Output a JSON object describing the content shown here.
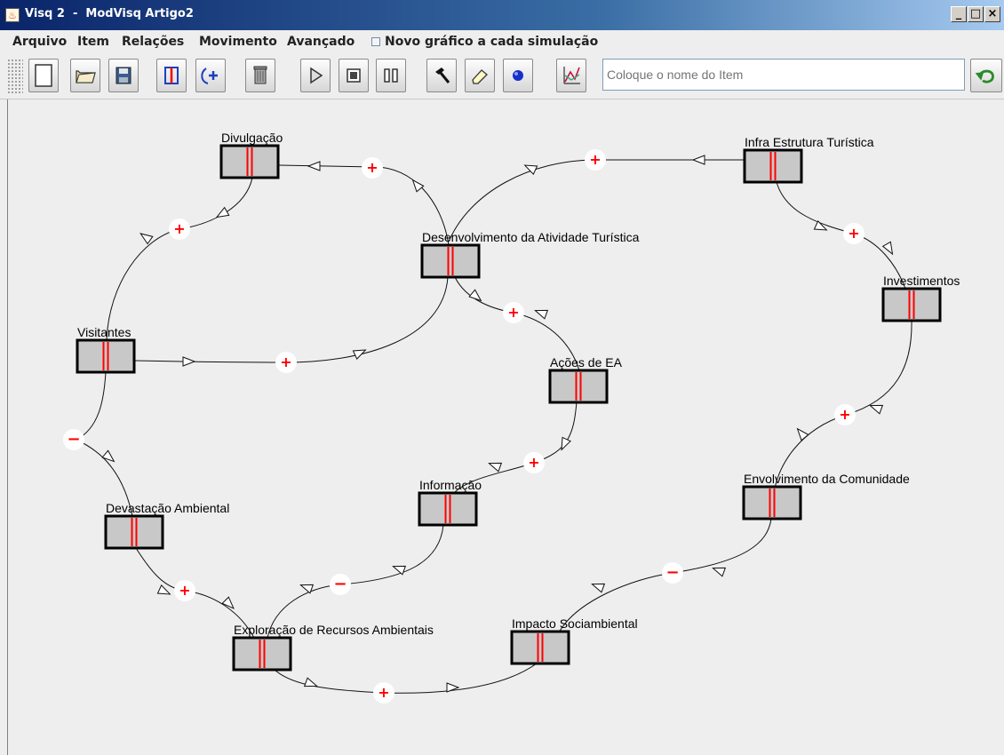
{
  "window": {
    "title": "Visq 2  -  ModVisq Artigo2"
  },
  "menu": {
    "items": [
      "Arquivo",
      "Item",
      "Relações",
      "Movimento",
      "Avançado"
    ],
    "checkbox_label": "Novo gráfico a cada simulação"
  },
  "toolbar": {
    "buttons": [
      "new-file-icon",
      "open-folder-icon",
      "save-disk-icon",
      "add-item-icon",
      "add-relation-icon",
      "trash-icon",
      "play-icon",
      "stop-icon",
      "pause-icon",
      "hammer-icon",
      "eraser-icon",
      "sphere-icon",
      "graph-icon"
    ],
    "item_name_placeholder": "Coloque o nome do Item",
    "undo_icon": "undo-icon"
  },
  "diagram": {
    "nodes": [
      {
        "label": "Divulgação"
      },
      {
        "label": "Infra Estrutura Turística"
      },
      {
        "label": "Desenvolvimento da Atividade Turística"
      },
      {
        "label": "Investimentos"
      },
      {
        "label": "Visitantes"
      },
      {
        "label": "Ações de EA"
      },
      {
        "label": "Informação"
      },
      {
        "label": "Envolvimento da Comunidade"
      },
      {
        "label": "Devastação Ambiental"
      },
      {
        "label": "Impacto Sociambiental"
      },
      {
        "label": "Exploração de Recursos Ambientais"
      }
    ],
    "links": [
      {
        "from": "Desenvolvimento da Atividade Turística",
        "to": "Divulgação",
        "sign": "+"
      },
      {
        "from": "Infra Estrutura Turística",
        "to": "Desenvolvimento da Atividade Turística",
        "sign": "+"
      },
      {
        "from": "Divulgação",
        "to": "Visitantes",
        "sign": "+"
      },
      {
        "from": "Infra Estrutura Turística",
        "to": "Investimentos",
        "sign": "+"
      },
      {
        "from": "Desenvolvimento da Atividade Turística",
        "to": "Ações de EA",
        "sign": "+"
      },
      {
        "from": "Visitantes",
        "to": "Desenvolvimento da Atividade Turística",
        "sign": "+"
      },
      {
        "from": "Investimentos",
        "to": "Envolvimento da Comunidade",
        "sign": "+"
      },
      {
        "from": "Ações de EA",
        "to": "Informação",
        "sign": "+"
      },
      {
        "from": "Visitantes",
        "to": "Devastação Ambiental",
        "sign": "-"
      },
      {
        "from": "Informação",
        "to": "Exploração de Recursos Ambientais",
        "sign": "-"
      },
      {
        "from": "Envolvimento da Comunidade",
        "to": "Impacto Sociambiental",
        "sign": "-"
      },
      {
        "from": "Devastação Ambiental",
        "to": "Exploração de Recursos Ambientais",
        "sign": "+"
      },
      {
        "from": "Exploração de Recursos Ambientais",
        "to": "Impacto Sociambiental",
        "sign": "+"
      }
    ]
  }
}
